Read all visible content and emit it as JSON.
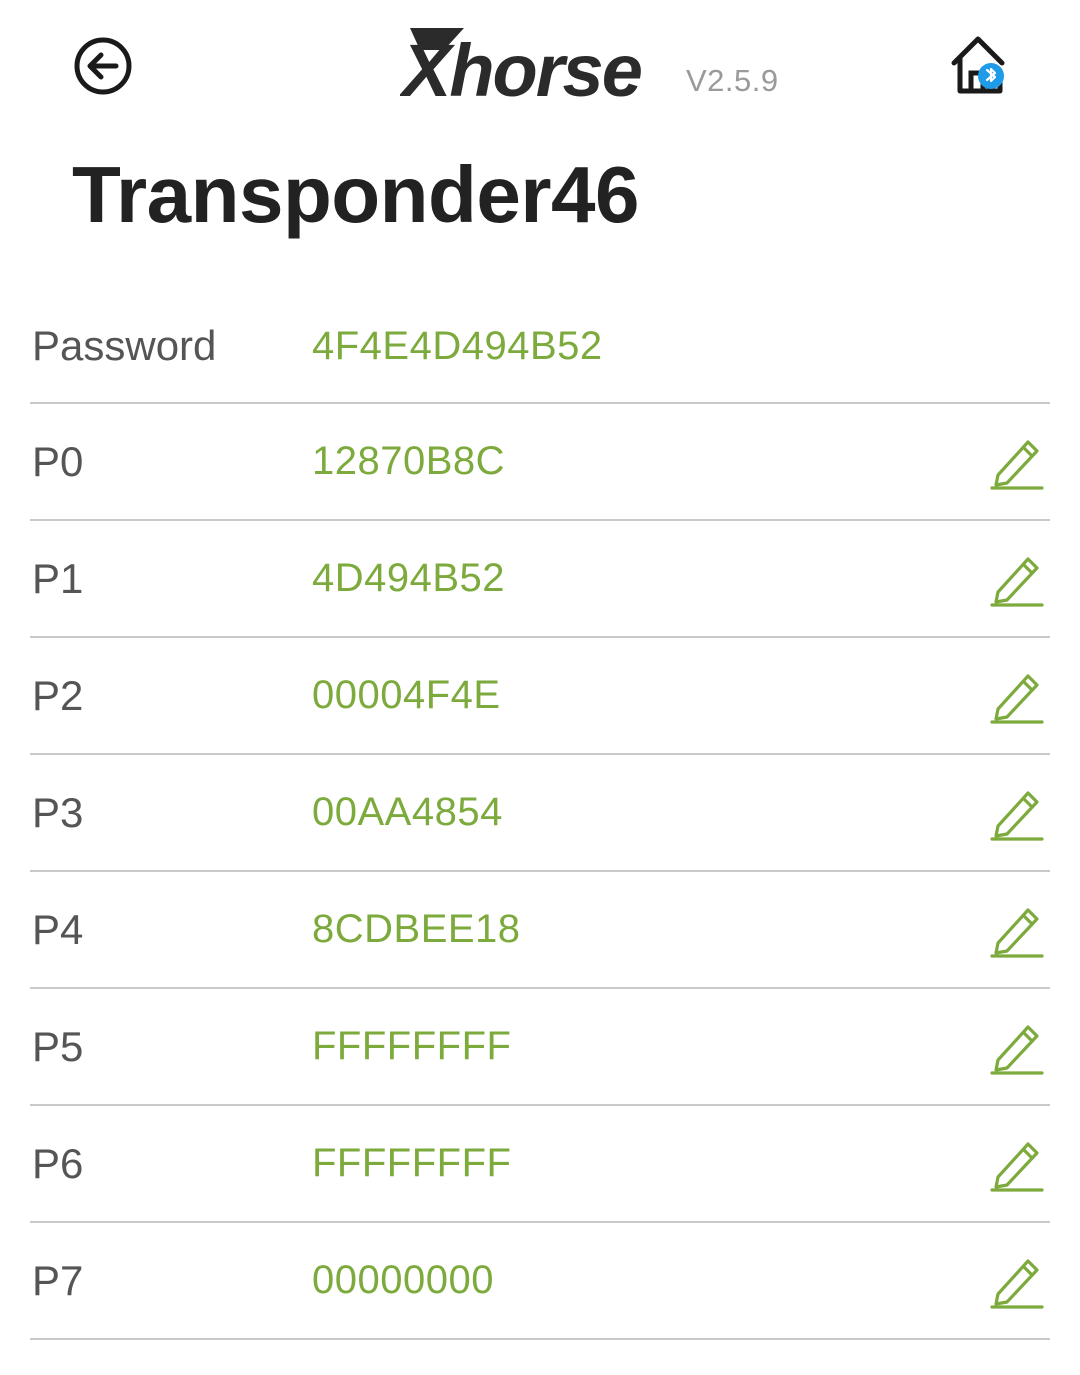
{
  "header": {
    "back_icon": "back-arrow-circle-icon",
    "brand_name": "Xhorse",
    "version": "V2.5.9",
    "device_icon": "home-bluetooth-icon",
    "bluetooth_color": "#1e9be9"
  },
  "page": {
    "title": "Transponder46"
  },
  "colors": {
    "value_green": "#7daa3c",
    "label_gray": "#555555",
    "divider": "#c9c9c9"
  },
  "rows": [
    {
      "label": "Password",
      "value": "4F4E4D494B52",
      "editable": false
    },
    {
      "label": "P0",
      "value": "12870B8C",
      "editable": true
    },
    {
      "label": "P1",
      "value": "4D494B52",
      "editable": true
    },
    {
      "label": "P2",
      "value": "00004F4E",
      "editable": true
    },
    {
      "label": "P3",
      "value": "00AA4854",
      "editable": true
    },
    {
      "label": "P4",
      "value": "8CDBEE18",
      "editable": true
    },
    {
      "label": "P5",
      "value": "FFFFFFFF",
      "editable": true
    },
    {
      "label": "P6",
      "value": "FFFFFFFF",
      "editable": true
    },
    {
      "label": "P7",
      "value": "00000000",
      "editable": true
    }
  ]
}
